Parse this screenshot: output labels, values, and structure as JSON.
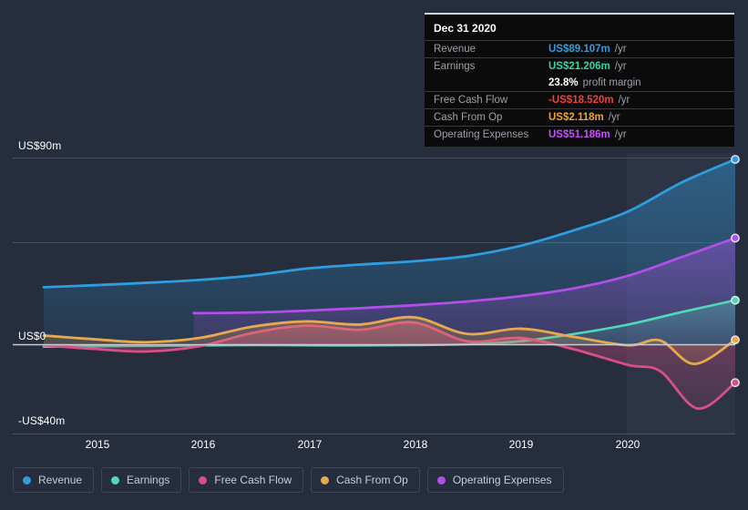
{
  "chart_data": {
    "type": "area",
    "title": "",
    "xlabel": "",
    "ylabel": "",
    "grid": true,
    "legend_position": "bottom",
    "ylim": [
      -40,
      90
    ],
    "y_ticks": [
      {
        "label": "US$90m",
        "value": 90
      },
      {
        "label": "US$0",
        "value": 0
      },
      {
        "label": "-US$40m",
        "value": -40
      }
    ],
    "x_ticks": [
      "2015",
      "2016",
      "2017",
      "2018",
      "2019",
      "2020"
    ],
    "x_range": [
      "2014-07",
      "2021-01"
    ],
    "series": [
      {
        "name": "Revenue",
        "color": "#2e9ee0",
        "x": [
          2014.55,
          2015.0,
          2015.5,
          2016.0,
          2016.5,
          2017.0,
          2017.5,
          2018.0,
          2018.5,
          2019.0,
          2019.5,
          2020.0,
          2020.5,
          2021.0
        ],
        "values": [
          27.5,
          28.4,
          29.6,
          31.0,
          33.2,
          36.5,
          38.4,
          40.0,
          42.5,
          47.5,
          55.0,
          64.0,
          78.0,
          89.107
        ]
      },
      {
        "name": "Earnings",
        "color": "#4fd9b8",
        "x": [
          2014.55,
          2015.0,
          2015.5,
          2016.0,
          2016.5,
          2017.0,
          2017.5,
          2018.0,
          2018.5,
          2019.0,
          2019.5,
          2020.0,
          2020.5,
          2021.0
        ],
        "values": [
          -1.2,
          -1.0,
          -0.8,
          -0.6,
          -0.4,
          -0.5,
          -0.6,
          -0.4,
          0.0,
          1.5,
          5.0,
          9.5,
          15.5,
          21.206
        ]
      },
      {
        "name": "Free Cash Flow",
        "color": "#d94f85",
        "x": [
          2014.55,
          2015.0,
          2015.5,
          2016.0,
          2016.5,
          2017.0,
          2017.5,
          2018.0,
          2018.5,
          2019.0,
          2019.5,
          2020.0,
          2020.3,
          2020.65,
          2021.0
        ],
        "values": [
          -0.5,
          -2.2,
          -3.5,
          -1.0,
          5.5,
          9.0,
          7.0,
          10.5,
          1.5,
          3.0,
          -2.5,
          -10.0,
          -13.0,
          -31.0,
          -18.52
        ]
      },
      {
        "name": "Cash From Op",
        "color": "#e8a84e",
        "x": [
          2014.55,
          2015.0,
          2015.5,
          2016.0,
          2016.5,
          2017.0,
          2017.5,
          2018.0,
          2018.5,
          2019.0,
          2019.5,
          2020.0,
          2020.3,
          2020.62,
          2021.0
        ],
        "values": [
          4.2,
          2.5,
          1.0,
          3.0,
          8.5,
          11.0,
          9.5,
          13.0,
          5.0,
          7.5,
          3.5,
          -0.5,
          1.8,
          -9.5,
          2.118
        ]
      },
      {
        "name": "Operating Expenses",
        "color": "#b14fe8",
        "x": [
          2015.95,
          2016.5,
          2017.0,
          2017.5,
          2018.0,
          2018.5,
          2019.0,
          2019.5,
          2020.0,
          2020.5,
          2021.0
        ],
        "values": [
          15.0,
          15.3,
          16.2,
          17.4,
          18.8,
          20.6,
          23.2,
          27.0,
          33.0,
          42.0,
          51.186
        ]
      }
    ],
    "endpoint_markers": [
      {
        "series": "Revenue",
        "value": 89.107
      },
      {
        "series": "Operating Expenses",
        "value": 51.186
      },
      {
        "series": "Earnings",
        "value": 21.206
      },
      {
        "series": "Cash From Op",
        "value": 2.118
      },
      {
        "series": "Free Cash Flow",
        "value": -18.52
      }
    ]
  },
  "tooltip": {
    "title": "Dec 31 2020",
    "rows": [
      {
        "label": "Revenue",
        "value": "US$89.107m",
        "unit": "/yr",
        "color": "#2e9ee0"
      },
      {
        "label": "Earnings",
        "value": "US$21.206m",
        "unit": "/yr",
        "color": "#2fd6a8"
      },
      {
        "label": "",
        "value": "23.8%",
        "unit": "profit margin",
        "color": "#ffffff"
      },
      {
        "label": "Free Cash Flow",
        "value": "-US$18.520m",
        "unit": "/yr",
        "color": "#f0403c"
      },
      {
        "label": "Cash From Op",
        "value": "US$2.118m",
        "unit": "/yr",
        "color": "#f0a22e"
      },
      {
        "label": "Operating Expenses",
        "value": "US$51.186m",
        "unit": "/yr",
        "color": "#c64fff"
      }
    ]
  },
  "legend": {
    "items": [
      {
        "label": "Revenue",
        "color": "#2e9ee0"
      },
      {
        "label": "Earnings",
        "color": "#4fd9b8"
      },
      {
        "label": "Free Cash Flow",
        "color": "#d94f85"
      },
      {
        "label": "Cash From Op",
        "color": "#e8a84e"
      },
      {
        "label": "Operating Expenses",
        "color": "#b14fe8"
      }
    ]
  }
}
